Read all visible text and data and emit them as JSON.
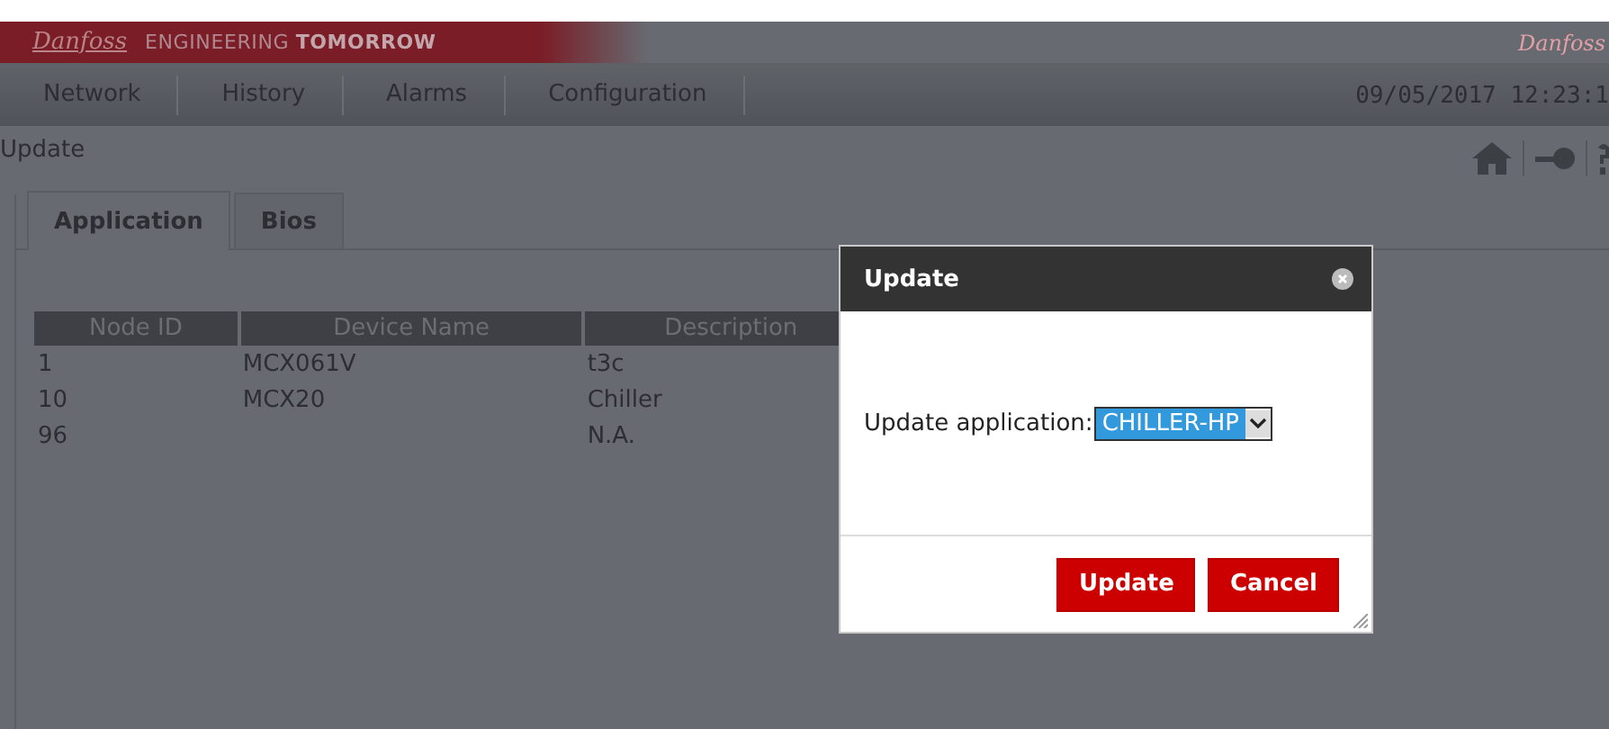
{
  "header": {
    "logo": "Danfoss",
    "slogan": "ENGINEERING **TOMORROW**",
    "corner_logo": "Danfoss"
  },
  "nav": {
    "items": [
      {
        "label": "Network"
      },
      {
        "label": "History"
      },
      {
        "label": "Alarms"
      },
      {
        "label": "Configuration"
      }
    ],
    "datetime": "09/05/2017 12:23:1"
  },
  "breadcrumb": "Update",
  "tabs": [
    {
      "label": "Application",
      "selected": true
    },
    {
      "label": "Bios",
      "selected": false
    }
  ],
  "table": {
    "columns": [
      "Node ID",
      "Device Name",
      "Description"
    ],
    "rows": [
      [
        "1",
        "MCX061V",
        "t3c"
      ],
      [
        "10",
        "MCX20",
        "Chiller"
      ],
      [
        "96",
        "",
        "N.A."
      ]
    ]
  },
  "dialog": {
    "title": "Update",
    "field_label": "Update application:",
    "select_value": "CHILLER-HP",
    "buttons": [
      {
        "label": "Update"
      },
      {
        "label": "Cancel"
      }
    ]
  }
}
